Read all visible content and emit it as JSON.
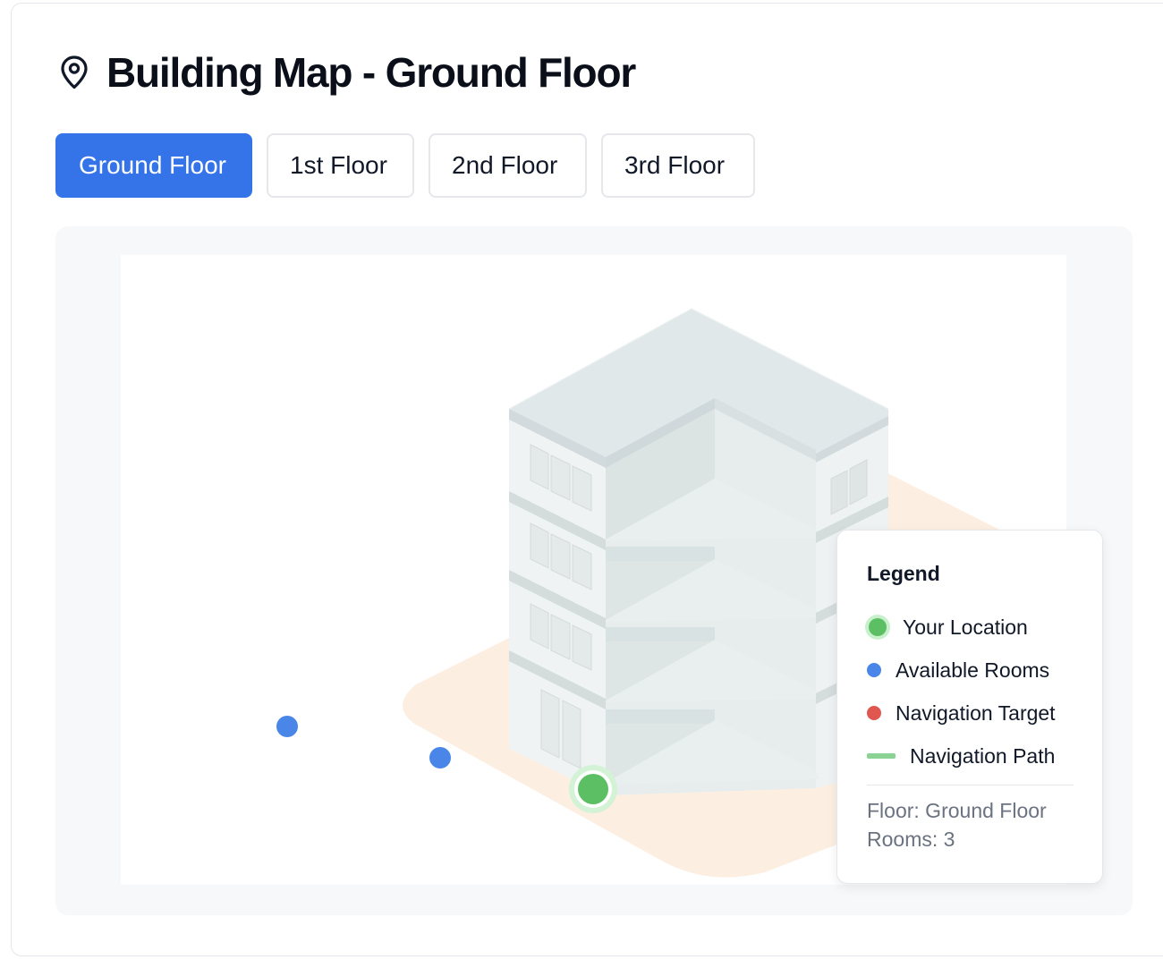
{
  "header": {
    "title": "Building Map - Ground Floor",
    "icon": "map-pin-icon"
  },
  "floor_tabs": [
    {
      "label": "Ground Floor",
      "active": true
    },
    {
      "label": "1st Floor",
      "active": false
    },
    {
      "label": "2nd Floor",
      "active": false
    },
    {
      "label": "3rd Floor",
      "active": false
    }
  ],
  "map": {
    "markers": [
      {
        "type": "available-room"
      },
      {
        "type": "available-room"
      },
      {
        "type": "your-location"
      }
    ]
  },
  "legend": {
    "title": "Legend",
    "items": [
      {
        "label": "Your Location",
        "color": "#5cbf64"
      },
      {
        "label": "Available Rooms",
        "color": "#4a86e8"
      },
      {
        "label": "Navigation Target",
        "color": "#e0574f"
      },
      {
        "label": "Navigation Path",
        "color": "#8bd394"
      }
    ],
    "floor_label": "Floor: Ground Floor",
    "rooms_label": "Rooms: 3"
  },
  "colors": {
    "primary": "#3474e8",
    "floor_pad": "#fcefe2"
  }
}
